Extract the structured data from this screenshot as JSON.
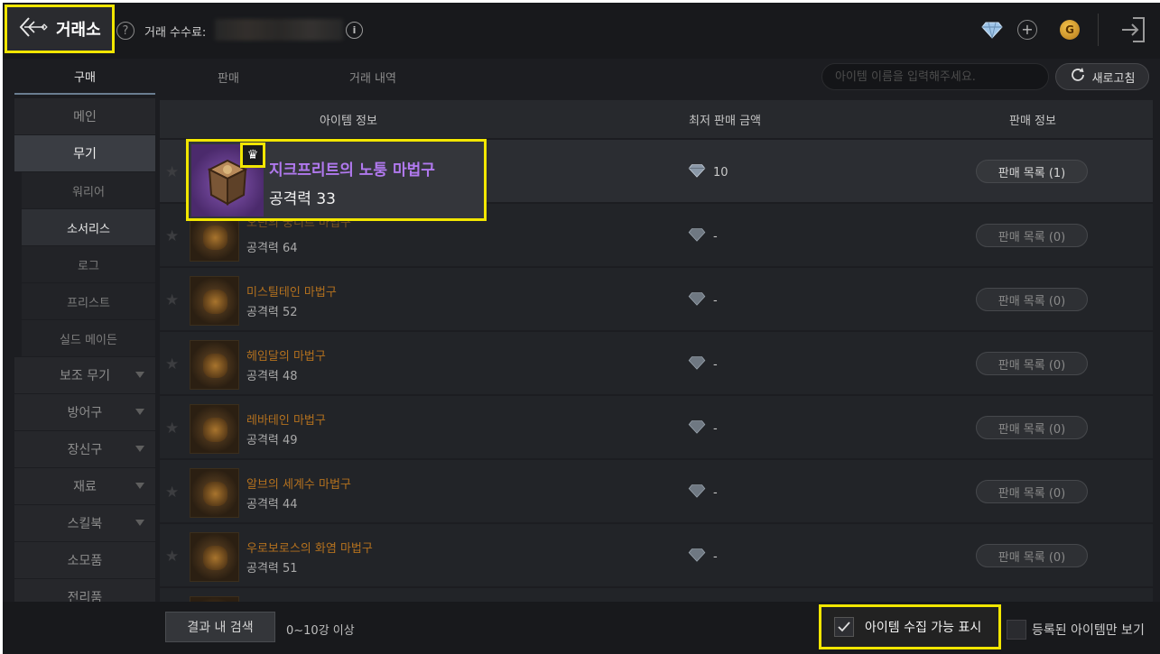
{
  "header": {
    "title": "거래소",
    "fee_label": "거래 수수료:",
    "gold_label": "G"
  },
  "tabs": [
    {
      "label": "구매",
      "active": true
    },
    {
      "label": "판매",
      "active": false
    },
    {
      "label": "거래 내역",
      "active": false
    }
  ],
  "search": {
    "placeholder": "아이템 이름을 입력해주세요."
  },
  "refresh_label": "새로고침",
  "sidebar": {
    "items": [
      {
        "label": "메인"
      },
      {
        "label": "무기"
      },
      {
        "label": "워리어"
      },
      {
        "label": "소서리스"
      },
      {
        "label": "로그"
      },
      {
        "label": "프리스트"
      },
      {
        "label": "실드 메이든"
      },
      {
        "label": "보조 무기"
      },
      {
        "label": "방어구"
      },
      {
        "label": "장신구"
      },
      {
        "label": "재료"
      },
      {
        "label": "스킬북"
      },
      {
        "label": "소모품"
      },
      {
        "label": "전리품"
      }
    ]
  },
  "table": {
    "headers": [
      "아이템 정보",
      "최저 판매 금액",
      "판매 정보"
    ],
    "rows": [
      {
        "name": "지크프리트의 노퉁 마법구",
        "attack": "공격력 33",
        "price": "10",
        "sell": "판매 목록 (1)"
      },
      {
        "name": "오딘의 궁니르 마법구",
        "attack": "공격력 64",
        "price": "-",
        "sell": "판매 목록 (0)"
      },
      {
        "name": "미스틸테인 마법구",
        "attack": "공격력 52",
        "price": "-",
        "sell": "판매 목록 (0)"
      },
      {
        "name": "헤임달의 마법구",
        "attack": "공격력 48",
        "price": "-",
        "sell": "판매 목록 (0)"
      },
      {
        "name": "레바테인 마법구",
        "attack": "공격력 49",
        "price": "-",
        "sell": "판매 목록 (0)"
      },
      {
        "name": "알브의 세계수 마법구",
        "attack": "공격력 44",
        "price": "-",
        "sell": "판매 목록 (0)"
      },
      {
        "name": "우로보로스의 화염 마법구",
        "attack": "공격력 51",
        "price": "-",
        "sell": "판매 목록 (0)"
      }
    ]
  },
  "bottom": {
    "result_search": "결과 내 검색",
    "range": "0~10강 이상",
    "collect_label": "아이템 수집 가능 표시",
    "registered_label": "등록된 아이템만 보기"
  }
}
